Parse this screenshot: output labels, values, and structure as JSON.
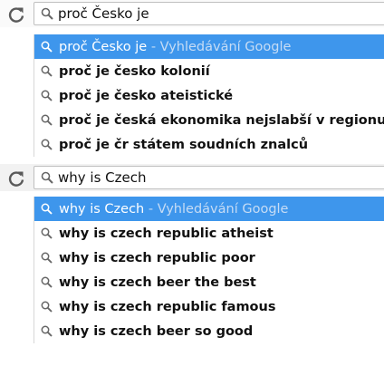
{
  "czech": {
    "query": "proč Česko je",
    "top_suggestion": {
      "text": "proč Česko je",
      "hint": "- Vyhledávání Google"
    },
    "suggestions": [
      "proč je česko kolonií",
      "proč je česko ateistické",
      "proč je česká ekonomika nejslabší v regionu",
      "proč je čr státem soudních znalců"
    ]
  },
  "english": {
    "query": "why is Czech",
    "top_suggestion": {
      "text": "why is Czech",
      "hint": "- Vyhledávání Google"
    },
    "suggestions": [
      "why is czech republic atheist",
      "why is czech republic poor",
      "why is czech beer the best",
      "why is czech republic famous",
      "why is czech beer so good"
    ]
  },
  "icons": {
    "reload": "reload-icon",
    "search": "search-icon"
  },
  "colors": {
    "selection": "#3e96ec",
    "hint_on_selection": "#c6dcf5"
  }
}
